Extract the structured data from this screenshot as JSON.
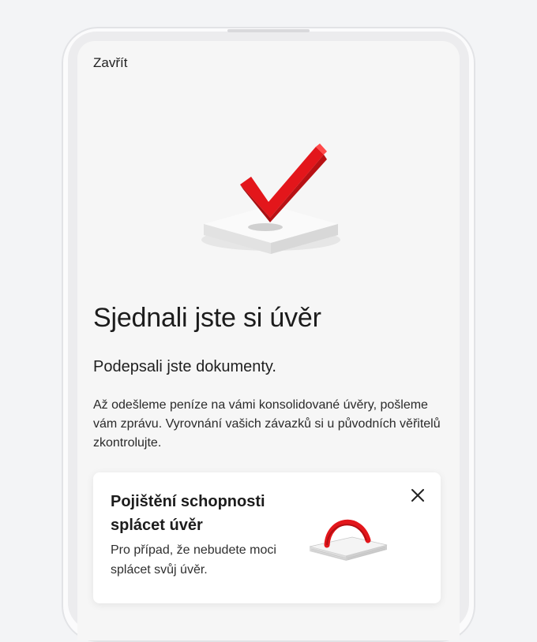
{
  "header": {
    "close_label": "Zavřít"
  },
  "hero": {
    "icon": "checkmark-illustration",
    "accent_color": "#e3161b"
  },
  "content": {
    "title": "Sjednali jste si úvěr",
    "subtitle": "Podepsali jste dokumenty.",
    "body": "Až odešleme peníze na vámi konsolidované úvěry, pošleme vám zprávu. Vyrovnání vašich závazků si u původních věřitelů zkontrolujte."
  },
  "promo_card": {
    "title": "Pojištění schopnosti splácet úvěr",
    "text": "Pro případ, že nebudete moci splácet svůj úvěr.",
    "close_icon": "close-icon",
    "illustration": "paper-stack-umbrella-illustration"
  }
}
